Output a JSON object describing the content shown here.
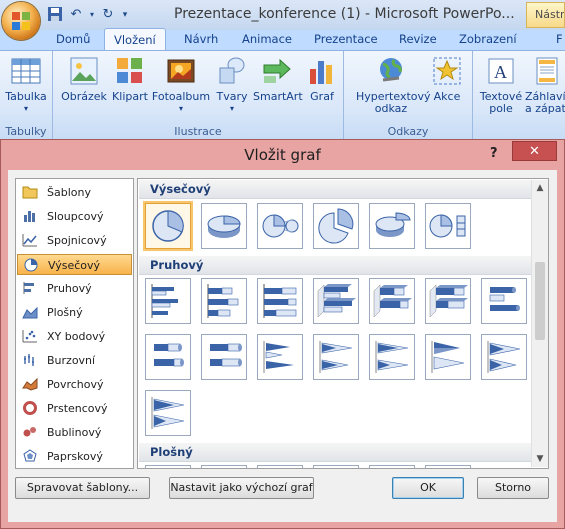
{
  "window": {
    "title": "Prezentace_konference (1) - Microsoft PowerPo...",
    "context_tab": "Nástro"
  },
  "qat": [
    "save-icon",
    "undo-icon",
    "undo-dropdown",
    "redo-icon",
    "qat-more"
  ],
  "tabs": [
    "Domů",
    "Vložení",
    "Návrh",
    "Animace",
    "Prezentace",
    "Revize",
    "Zobrazení",
    "F"
  ],
  "ribbon": {
    "groups": {
      "tabulky": "Tabulky",
      "ilustrace": "Ilustrace",
      "odkazy": "Odkazy"
    },
    "buttons": {
      "tabulka": "Tabulka",
      "obrazek": "Obrázek",
      "klipart": "Klipart",
      "fotoalbum": "Fotoalbum",
      "tvary": "Tvary",
      "smartart": "SmartArt",
      "graf": "Graf",
      "hypertext_1": "Hypertextový",
      "hypertext_2": "odkaz",
      "akce": "Akce",
      "textove_1": "Textové",
      "textove_2": "pole",
      "zahlavi_1": "Záhlaví",
      "zahlavi_2": "a zápatí"
    }
  },
  "dialog": {
    "title": "Vložit graf",
    "help": "?",
    "close": "✕",
    "categories": [
      "Šablony",
      "Sloupcový",
      "Spojnicový",
      "Výsečový",
      "Pruhový",
      "Plošný",
      "XY bodový",
      "Burzovní",
      "Povrchový",
      "Prstencový",
      "Bublinový",
      "Paprskový"
    ],
    "selected_category": "Výsečový",
    "sections": {
      "pie": "Výsečový",
      "bar": "Pruhový",
      "area": "Plošný"
    },
    "buttons": {
      "manage": "Spravovat šablony...",
      "default": "Nastavit jako výchozí graf",
      "ok": "OK",
      "cancel": "Storno"
    }
  }
}
